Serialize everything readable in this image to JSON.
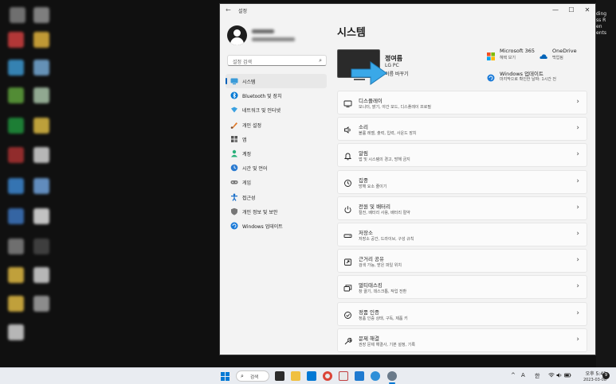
{
  "window": {
    "title": "설정",
    "back_glyph": "←",
    "minimize_glyph": "—",
    "maximize_glyph": "☐",
    "close_glyph": "✕"
  },
  "desktop_right": {
    "text": "ding\nss R\nen\nents"
  },
  "search": {
    "placeholder": "설정 검색"
  },
  "nav": {
    "items": [
      {
        "label": "시스템",
        "icon": "system-icon"
      },
      {
        "label": "Bluetooth 및 장치",
        "icon": "bluetooth-icon"
      },
      {
        "label": "네트워크 및 인터넷",
        "icon": "network-icon"
      },
      {
        "label": "개인 설정",
        "icon": "personalization-icon"
      },
      {
        "label": "앱",
        "icon": "apps-icon"
      },
      {
        "label": "계정",
        "icon": "accounts-icon"
      },
      {
        "label": "시간 및 언어",
        "icon": "time-language-icon"
      },
      {
        "label": "게임",
        "icon": "gaming-icon"
      },
      {
        "label": "접근성",
        "icon": "accessibility-icon"
      },
      {
        "label": "개인 정보 및 보안",
        "icon": "privacy-icon"
      },
      {
        "label": "Windows 업데이트",
        "icon": "windows-update-icon"
      }
    ]
  },
  "page": {
    "title": "시스템"
  },
  "device": {
    "name": "정여름",
    "model": "LG PC",
    "rename": "이름 바꾸기"
  },
  "quick": {
    "m365": {
      "title": "Microsoft 365",
      "sub": "혜택 보기"
    },
    "onedrive": {
      "title": "OneDrive",
      "sub": "백업됨"
    },
    "update": {
      "title": "Windows 업데이트",
      "sub": "마지막으로 확인한 날짜: 1시간 전"
    }
  },
  "cards": [
    {
      "title": "디스플레이",
      "sub": "모니터, 밝기, 야간 모드, 디스플레이 프로필",
      "icon": "display-icon"
    },
    {
      "title": "소리",
      "sub": "볼륨 레벨, 출력, 입력, 사운드 장치",
      "icon": "sound-icon"
    },
    {
      "title": "알림",
      "sub": "앱 및 시스템의 경고, 방해 금지",
      "icon": "notifications-icon"
    },
    {
      "title": "집중",
      "sub": "방해 요소 줄이기",
      "icon": "focus-icon"
    },
    {
      "title": "전원 및 배터리",
      "sub": "절전, 배터리 사용, 배터리 절약",
      "icon": "power-icon"
    },
    {
      "title": "저장소",
      "sub": "저장소 공간, 드라이브, 구성 규칙",
      "icon": "storage-icon"
    },
    {
      "title": "근거리 공유",
      "sub": "검색 가능, 받은 파일 위치",
      "icon": "nearby-sharing-icon"
    },
    {
      "title": "멀티태스킹",
      "sub": "창 끌기, 데스크톱, 작업 전환",
      "icon": "multitasking-icon"
    },
    {
      "title": "정품 인증",
      "sub": "정품 인증 상태, 구독, 제품 키",
      "icon": "activation-icon"
    },
    {
      "title": "문제 해결",
      "sub": "권장 문제 해결사, 기본 설정, 기록",
      "icon": "troubleshoot-icon"
    }
  ],
  "taskbar": {
    "search_label": "검색",
    "tray": {
      "chevron": "^",
      "lang_a": "A",
      "ime": "한"
    },
    "time": "오후 5:42",
    "date": "2023-03-08",
    "notif_count": "9"
  },
  "colors": {
    "accent": "#005fb8",
    "window_bg": "#f3f3f3",
    "card_bg": "#fbfbfb",
    "taskbar_bg": "#e9ecf1"
  }
}
